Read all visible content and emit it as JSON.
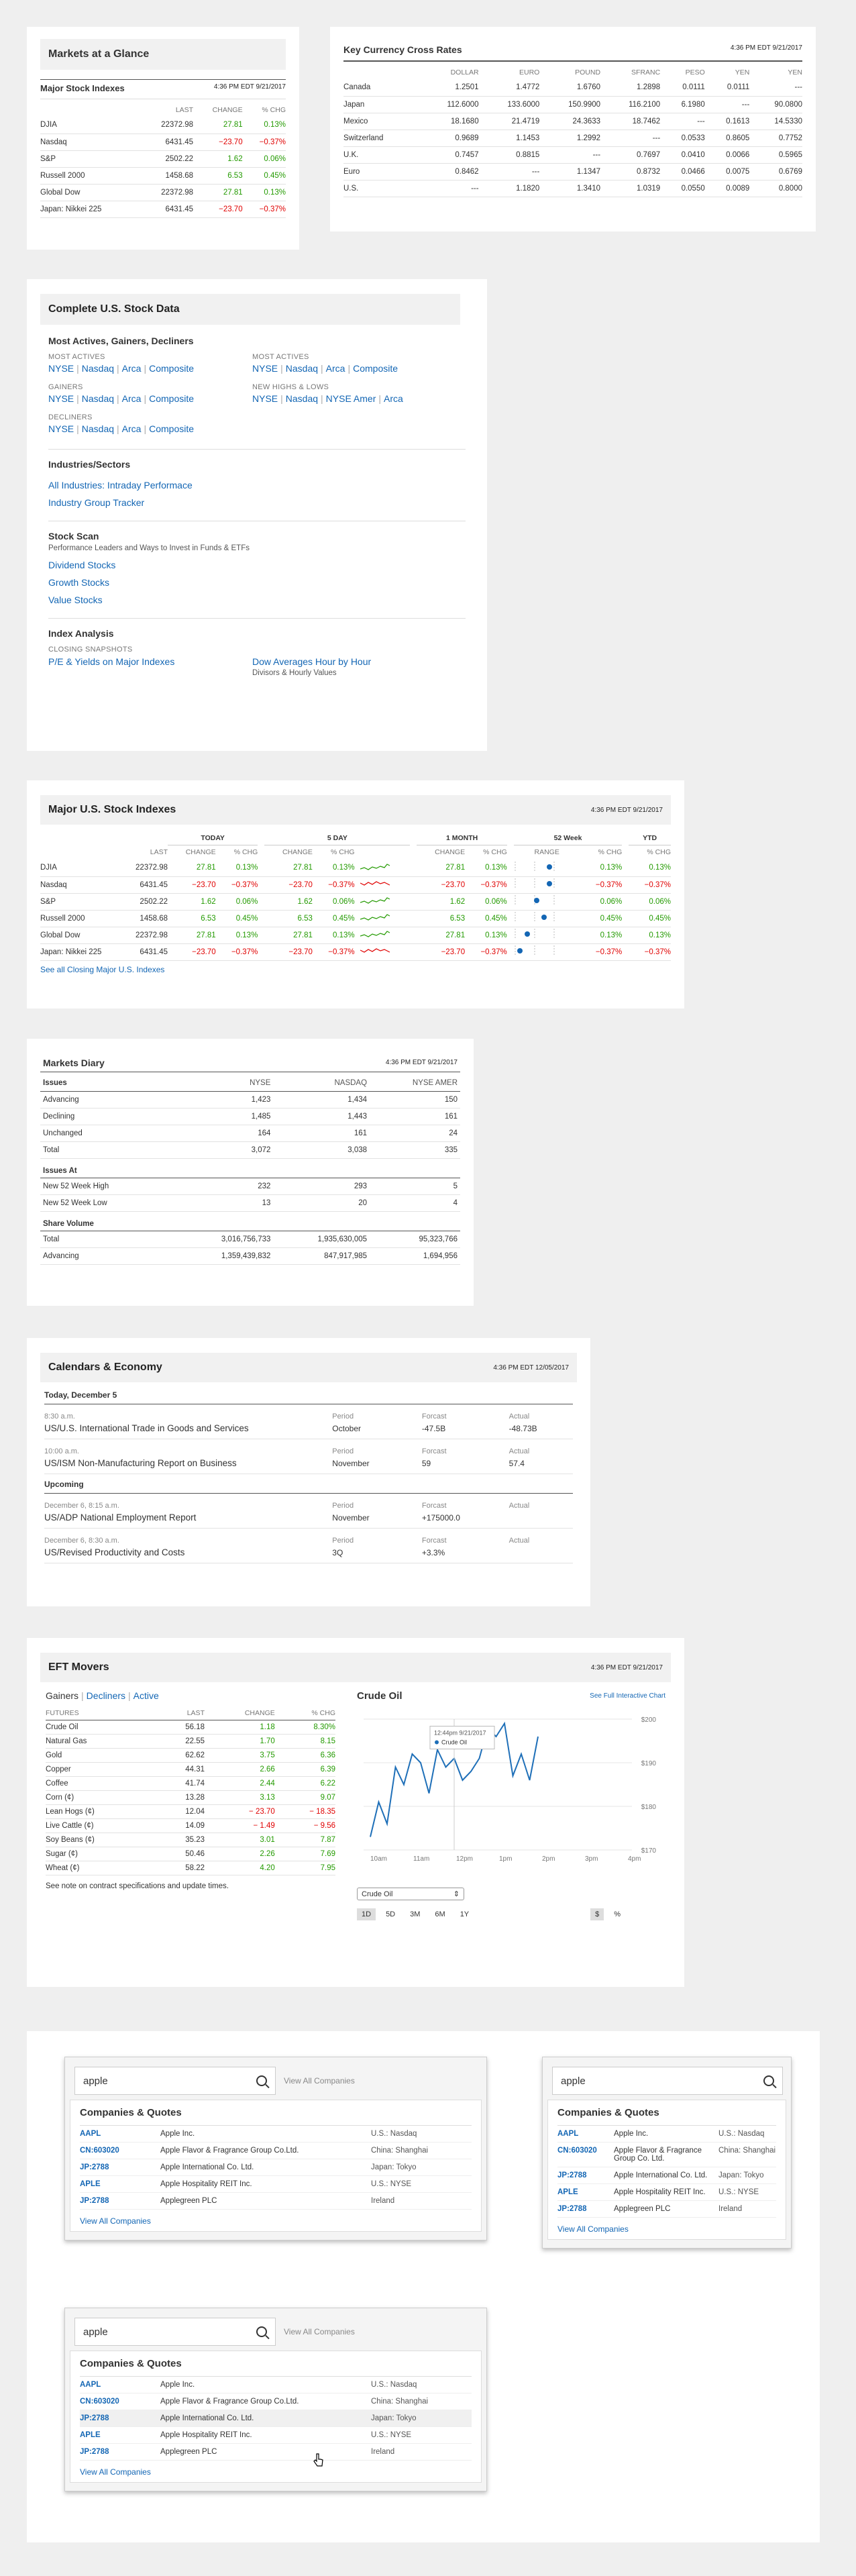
{
  "glance": {
    "title": "Markets at a Glance",
    "sub": "Major Stock Indexes",
    "ts": "4:36 PM EDT 9/21/2017",
    "cols": [
      "LAST",
      "CHANGE",
      "% CHG"
    ],
    "rows": [
      {
        "name": "DJIA",
        "last": "22372.98",
        "chg": "27.81",
        "pct": "0.13%",
        "neg": false
      },
      {
        "name": "Nasdaq",
        "last": "6431.45",
        "chg": "−23.70",
        "pct": "−0.37%",
        "neg": true
      },
      {
        "name": "S&P",
        "last": "2502.22",
        "chg": "1.62",
        "pct": "0.06%",
        "neg": false
      },
      {
        "name": "Russell 2000",
        "last": "1458.68",
        "chg": "6.53",
        "pct": "0.45%",
        "neg": false
      },
      {
        "name": "Global Dow",
        "last": "22372.98",
        "chg": "27.81",
        "pct": "0.13%",
        "neg": false
      },
      {
        "name": "Japan: Nikkei 225",
        "last": "6431.45",
        "chg": "−23.70",
        "pct": "−0.37%",
        "neg": true
      }
    ]
  },
  "fx": {
    "title": "Key Currency Cross Rates",
    "ts": "4:36 PM EDT 9/21/2017",
    "cols": [
      "DOLLAR",
      "EURO",
      "POUND",
      "SFRANC",
      "PESO",
      "YEN",
      "YEN"
    ],
    "rows": [
      {
        "name": "Canada",
        "v": [
          "1.2501",
          "1.4772",
          "1.6760",
          "1.2898",
          "0.0111",
          "0.0111",
          "---"
        ]
      },
      {
        "name": "Japan",
        "v": [
          "112.6000",
          "133.6000",
          "150.9900",
          "116.2100",
          "6.1980",
          "---",
          "90.0800"
        ]
      },
      {
        "name": "Mexico",
        "v": [
          "18.1680",
          "21.4719",
          "24.3633",
          "18.7462",
          "---",
          "0.1613",
          "14.5330"
        ]
      },
      {
        "name": "Switzerland",
        "v": [
          "0.9689",
          "1.1453",
          "1.2992",
          "---",
          "0.0533",
          "0.8605",
          "0.7752"
        ]
      },
      {
        "name": "U.K.",
        "v": [
          "0.7457",
          "0.8815",
          "---",
          "0.7697",
          "0.0410",
          "0.0066",
          "0.5965"
        ]
      },
      {
        "name": "Euro",
        "v": [
          "0.8462",
          "---",
          "1.1347",
          "0.8732",
          "0.0466",
          "0.0075",
          "0.6769"
        ]
      },
      {
        "name": "U.S.",
        "v": [
          "---",
          "1.1820",
          "1.3410",
          "1.0319",
          "0.0550",
          "0.0089",
          "0.8000"
        ]
      }
    ]
  },
  "complete": {
    "title": "Complete U.S. Stock Data",
    "s1": "Most Actives, Gainers, Decliners",
    "most_actives": "MOST ACTIVES",
    "most_actives2": "MOST ACTIVES",
    "gainers": "GAINERS",
    "highs": "NEW HIGHS & LOWS",
    "decliners": "DECLINERS",
    "links_a": [
      "NYSE",
      "Nasdaq",
      "Arca",
      "Composite"
    ],
    "links_b": [
      "NYSE",
      "Nasdaq",
      "Arca",
      "Composite"
    ],
    "links_c": [
      "NYSE",
      "Nasdaq",
      "Arca",
      "Composite"
    ],
    "links_d": [
      "NYSE",
      "Nasdaq",
      "NYSE Amer",
      "Arca"
    ],
    "links_e": [
      "NYSE",
      "Nasdaq",
      "Arca",
      "Composite"
    ],
    "s2": "Industries/Sectors",
    "ind1": "All Industries: Intraday Performace",
    "ind2": "Industry Group Tracker",
    "s3": "Stock Scan",
    "s3sub": "Performance Leaders and Ways to Invest in Funds & ETFs",
    "scan": [
      "Dividend Stocks",
      "Growth Stocks",
      "Value Stocks"
    ],
    "s4": "Index Analysis",
    "closing": "CLOSING SNAPSHOTS",
    "pe": "P/E & Yields on Major Indexes",
    "dow": "Dow Averages Hour by Hour",
    "dowsub": "Divisors & Hourly Values"
  },
  "major": {
    "title": "Major U.S. Stock Indexes",
    "ts": "4:36 PM EDT 9/21/2017",
    "groups": [
      "TODAY",
      "5 DAY",
      "1 MONTH",
      "52 Week",
      "YTD"
    ],
    "cols": [
      "LAST",
      "CHANGE",
      "% CHG",
      "CHANGE",
      "% CHG",
      "CHANGE",
      "% CHG",
      "RANGE",
      "% CHG",
      "% CHG"
    ],
    "rows": [
      {
        "name": "DJIA",
        "last": "22372.98",
        "c1": "27.81",
        "p1": "0.13%",
        "c5": "27.81",
        "p5": "0.13%",
        "cm": "27.81",
        "pm": "0.13%",
        "range": 0.9,
        "p52": "0.13%",
        "ytd": "0.13%",
        "neg": false
      },
      {
        "name": "Nasdaq",
        "last": "6431.45",
        "c1": "−23.70",
        "p1": "−0.37%",
        "c5": "−23.70",
        "p5": "−0.37%",
        "cm": "−23.70",
        "pm": "−0.37%",
        "range": 0.9,
        "p52": "−0.37%",
        "ytd": "−0.37%",
        "neg": true
      },
      {
        "name": "S&P",
        "last": "2502.22",
        "c1": "1.62",
        "p1": "0.06%",
        "c5": "1.62",
        "p5": "0.06%",
        "cm": "1.62",
        "pm": "0.06%",
        "range": 0.55,
        "p52": "0.06%",
        "ytd": "0.06%",
        "neg": false
      },
      {
        "name": "Russell 2000",
        "last": "1458.68",
        "c1": "6.53",
        "p1": "0.45%",
        "c5": "6.53",
        "p5": "0.45%",
        "cm": "6.53",
        "pm": "0.45%",
        "range": 0.75,
        "p52": "0.45%",
        "ytd": "0.45%",
        "neg": false
      },
      {
        "name": "Global Dow",
        "last": "22372.98",
        "c1": "27.81",
        "p1": "0.13%",
        "c5": "27.81",
        "p5": "0.13%",
        "cm": "27.81",
        "pm": "0.13%",
        "range": 0.3,
        "p52": "0.13%",
        "ytd": "0.13%",
        "neg": false
      },
      {
        "name": "Japan: Nikkei 225",
        "last": "6431.45",
        "c1": "−23.70",
        "p1": "−0.37%",
        "c5": "−23.70",
        "p5": "−0.37%",
        "cm": "−23.70",
        "pm": "−0.37%",
        "range": 0.1,
        "p52": "−0.37%",
        "ytd": "−0.37%",
        "neg": true
      }
    ],
    "link": "See all Closing Major U.S. Indexes"
  },
  "diary": {
    "title": "Markets Diary",
    "ts": "4:36 PM EDT 9/21/2017",
    "cols": [
      "Issues",
      "NYSE",
      "NASDAQ",
      "NYSE AMER"
    ],
    "issues": [
      [
        "Advancing",
        "1,423",
        "1,434",
        "150"
      ],
      [
        "Declining",
        "1,485",
        "1,443",
        "161"
      ],
      [
        "Unchanged",
        "164",
        "161",
        "24"
      ],
      [
        "Total",
        "3,072",
        "3,038",
        "335"
      ]
    ],
    "at": "Issues At",
    "at_rows": [
      [
        "New 52 Week High",
        "232",
        "293",
        "5"
      ],
      [
        "New 52 Week Low",
        "13",
        "20",
        "4"
      ]
    ],
    "vol": "Share Volume",
    "vol_rows": [
      [
        "Total",
        "3,016,756,733",
        "1,935,630,005",
        "95,323,766"
      ],
      [
        "Advancing",
        "1,359,439,832",
        "847,917,985",
        "1,694,956"
      ]
    ]
  },
  "cal": {
    "title": "Calendars & Economy",
    "ts": "4:36 PM EDT 12/05/2017",
    "today": "Today, December 5",
    "upcoming": "Upcoming",
    "today_items": [
      {
        "time": "8:30 a.m.",
        "name": "US/U.S. International Trade in Goods and Services",
        "period_l": "Period",
        "period": "October",
        "fc_l": "Forcast",
        "fc": "-47.5B",
        "ac_l": "Actual",
        "ac": "-48.73B"
      },
      {
        "time": "10:00 a.m.",
        "name": "US/ISM Non-Manufacturing Report on Business",
        "period_l": "Period",
        "period": "November",
        "fc_l": "Forcast",
        "fc": "59",
        "ac_l": "Actual",
        "ac": "57.4"
      }
    ],
    "up_items": [
      {
        "time": "December 6, 8:15 a.m.",
        "name": "US/ADP National Employment Report",
        "period_l": "Period",
        "period": "November",
        "fc_l": "Forcast",
        "fc": "+175000.0",
        "ac_l": "Actual",
        "ac": ""
      },
      {
        "time": "December 6, 8:30 a.m.",
        "name": "US/Revised Productivity and Costs",
        "period_l": "Period",
        "period": "3Q",
        "fc_l": "Forcast",
        "fc": "+3.3%",
        "ac_l": "Actual",
        "ac": ""
      }
    ]
  },
  "eft": {
    "title": "EFT Movers",
    "ts": "4:36 PM EDT 9/21/2017",
    "tabs": [
      "Gainers",
      "Decliners",
      "Active"
    ],
    "cols": [
      "FUTURES",
      "LAST",
      "CHANGE",
      "% CHG"
    ],
    "rows": [
      {
        "name": "Crude Oil",
        "last": "56.18",
        "chg": "1.18",
        "pct": "8.30%",
        "neg": false
      },
      {
        "name": "Natural Gas",
        "last": "22.55",
        "chg": "1.70",
        "pct": "8.15",
        "neg": false
      },
      {
        "name": "Gold",
        "last": "62.62",
        "chg": "3.75",
        "pct": "6.36",
        "neg": false
      },
      {
        "name": "Copper",
        "last": "44.31",
        "chg": "2.66",
        "pct": "6.39",
        "neg": false
      },
      {
        "name": "Coffee",
        "last": "41.74",
        "chg": "2.44",
        "pct": "6.22",
        "neg": false
      },
      {
        "name": "Corn (¢)",
        "last": "13.28",
        "chg": "3.13",
        "pct": "9.07",
        "neg": false
      },
      {
        "name": "Lean Hogs (¢)",
        "last": "12.04",
        "chg": "23.70",
        "pct": "18.35",
        "neg": true
      },
      {
        "name": "Live Cattle (¢)",
        "last": "14.09",
        "chg": "1.49",
        "pct": "9.56",
        "neg": true
      },
      {
        "name": "Soy Beans (¢)",
        "last": "35.23",
        "chg": "3.01",
        "pct": "7.87",
        "neg": false
      },
      {
        "name": "Sugar (¢)",
        "last": "50.46",
        "chg": "2.26",
        "pct": "7.69",
        "neg": false
      },
      {
        "name": "Wheat (¢)",
        "last": "58.22",
        "chg": "4.20",
        "pct": "7.95",
        "neg": false
      }
    ],
    "note": "See note on contract specifications and update times.",
    "chart_title": "Crude Oil",
    "chart_link": "See Full Interactive Chart",
    "select": "Crude Oil",
    "ranges": [
      "1D",
      "5D",
      "3M",
      "6M",
      "1Y"
    ],
    "modes": [
      "$",
      "%"
    ],
    "tip_time": "12:44pm 9/21/2017",
    "tip_name": "Crude Oil"
  },
  "chart_data": {
    "type": "line",
    "title": "Crude Oil",
    "x": [
      "10am",
      "",
      "",
      "11am",
      "",
      "",
      "12pm",
      "",
      "",
      "1pm",
      "",
      "",
      "2pm"
    ],
    "ylim": [
      170,
      200
    ],
    "yticks": [
      "$200",
      "$190",
      "$180",
      "$170"
    ],
    "xticks": [
      "10am",
      "11am",
      "12pm",
      "1pm",
      "2pm",
      "3pm",
      "4pm"
    ],
    "values": [
      173,
      181,
      176,
      189,
      185,
      192,
      190,
      183,
      193,
      189,
      191,
      186,
      188,
      191,
      198,
      196,
      199,
      187,
      192,
      186,
      196
    ]
  },
  "search": {
    "value": "apple",
    "all": "View All Companies",
    "head": "Companies & Quotes",
    "viewall": "View All Companies",
    "rows": [
      {
        "sym": "AAPL",
        "name": "Apple Inc.",
        "ex": "U.S.: Nasdaq"
      },
      {
        "sym": "CN:603020",
        "name": "Apple Flavor & Fragrance Group Co.Ltd.",
        "ex": "China: Shanghai"
      },
      {
        "sym": "JP:2788",
        "name": "Apple International Co. Ltd.",
        "ex": "Japan: Tokyo"
      },
      {
        "sym": "APLE",
        "name": "Apple Hospitality REIT Inc.",
        "ex": "U.S.: NYSE"
      },
      {
        "sym": "JP:2788",
        "name": "Applegreen PLC",
        "ex": "Ireland"
      }
    ],
    "sm_rows": [
      {
        "sym": "AAPL",
        "name": "Apple Inc.",
        "ex": "U.S.: Nasdaq"
      },
      {
        "sym": "CN:603020",
        "name": "Apple Flavor & Fragrance Group Co. Ltd.",
        "ex": "China: Shanghai"
      },
      {
        "sym": "JP:2788",
        "name": "Apple International Co. Ltd.",
        "ex": "Japan: Tokyo"
      },
      {
        "sym": "APLE",
        "name": "Apple Hospitality REIT Inc.",
        "ex": "U.S.: NYSE"
      },
      {
        "sym": "JP:2788",
        "name": "Applegreen PLC",
        "ex": "Ireland"
      }
    ]
  }
}
